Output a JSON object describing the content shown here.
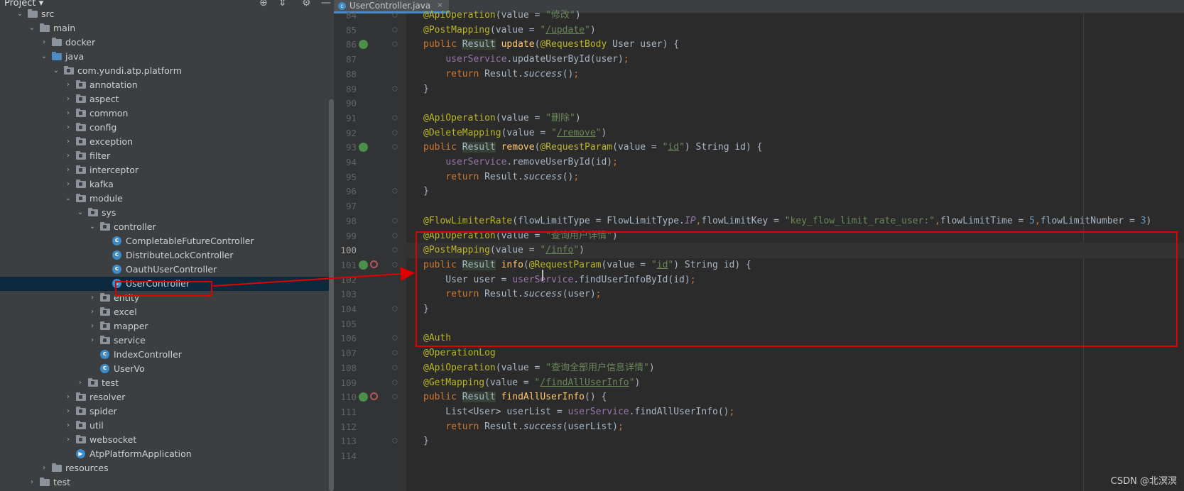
{
  "sidebar": {
    "title": "Project",
    "tree": [
      {
        "label": "src",
        "indent": 1,
        "chev": "down",
        "icon": "folder"
      },
      {
        "label": "main",
        "indent": 2,
        "chev": "down",
        "icon": "folder"
      },
      {
        "label": "docker",
        "indent": 3,
        "chev": "right",
        "icon": "folder"
      },
      {
        "label": "java",
        "indent": 3,
        "chev": "down",
        "icon": "folder-blue"
      },
      {
        "label": "com.yundi.atp.platform",
        "indent": 4,
        "chev": "down",
        "icon": "pkg"
      },
      {
        "label": "annotation",
        "indent": 5,
        "chev": "right",
        "icon": "pkg"
      },
      {
        "label": "aspect",
        "indent": 5,
        "chev": "right",
        "icon": "pkg"
      },
      {
        "label": "common",
        "indent": 5,
        "chev": "right",
        "icon": "pkg"
      },
      {
        "label": "config",
        "indent": 5,
        "chev": "right",
        "icon": "pkg"
      },
      {
        "label": "exception",
        "indent": 5,
        "chev": "right",
        "icon": "pkg"
      },
      {
        "label": "filter",
        "indent": 5,
        "chev": "right",
        "icon": "pkg"
      },
      {
        "label": "interceptor",
        "indent": 5,
        "chev": "right",
        "icon": "pkg"
      },
      {
        "label": "kafka",
        "indent": 5,
        "chev": "right",
        "icon": "pkg"
      },
      {
        "label": "module",
        "indent": 5,
        "chev": "down",
        "icon": "pkg"
      },
      {
        "label": "sys",
        "indent": 6,
        "chev": "down",
        "icon": "pkg"
      },
      {
        "label": "controller",
        "indent": 7,
        "chev": "down",
        "icon": "pkg"
      },
      {
        "label": "CompletableFutureController",
        "indent": 8,
        "chev": "none",
        "icon": "class"
      },
      {
        "label": "DistributeLockController",
        "indent": 8,
        "chev": "none",
        "icon": "class"
      },
      {
        "label": "OauthUserController",
        "indent": 8,
        "chev": "none",
        "icon": "class"
      },
      {
        "label": "UserController",
        "indent": 8,
        "chev": "none",
        "icon": "class",
        "selected": true
      },
      {
        "label": "entity",
        "indent": 7,
        "chev": "right",
        "icon": "pkg"
      },
      {
        "label": "excel",
        "indent": 7,
        "chev": "right",
        "icon": "pkg"
      },
      {
        "label": "mapper",
        "indent": 7,
        "chev": "right",
        "icon": "pkg"
      },
      {
        "label": "service",
        "indent": 7,
        "chev": "right",
        "icon": "pkg"
      },
      {
        "label": "IndexController",
        "indent": 7,
        "chev": "none",
        "icon": "class"
      },
      {
        "label": "UserVo",
        "indent": 7,
        "chev": "none",
        "icon": "class"
      },
      {
        "label": "test",
        "indent": 6,
        "chev": "right",
        "icon": "pkg"
      },
      {
        "label": "resolver",
        "indent": 5,
        "chev": "right",
        "icon": "pkg"
      },
      {
        "label": "spider",
        "indent": 5,
        "chev": "right",
        "icon": "pkg"
      },
      {
        "label": "util",
        "indent": 5,
        "chev": "right",
        "icon": "pkg"
      },
      {
        "label": "websocket",
        "indent": 5,
        "chev": "right",
        "icon": "pkg"
      },
      {
        "label": "AtpPlatformApplication",
        "indent": 5,
        "chev": "none",
        "icon": "app"
      },
      {
        "label": "resources",
        "indent": 3,
        "chev": "right",
        "icon": "folder"
      },
      {
        "label": "test",
        "indent": 2,
        "chev": "right",
        "icon": "folder"
      }
    ]
  },
  "editor": {
    "tab_label": "UserController.java",
    "tab_close": "×",
    "current_line": 100,
    "lines": [
      {
        "n": 84,
        "html": "<span class='a'>@ApiOperation</span>(value = <span class='s'>\"修改\"</span>)"
      },
      {
        "n": 85,
        "html": "<span class='a'>@PostMapping</span>(value = <span class='s'>\"<span class='u'>/update</span>\"</span>)"
      },
      {
        "n": 86,
        "html": "<span class='k'>public </span><span class='hl'>Result</span> <span class='m'>update</span>(<span class='a'>@RequestBody</span> User user) {",
        "g1": true
      },
      {
        "n": 87,
        "html": "    <span class='f'>userService</span>.updateUserById(user)<span class='k'>;</span>"
      },
      {
        "n": 88,
        "html": "    <span class='k'>return </span>Result.<span class='i'>success</span>()<span class='k'>;</span>"
      },
      {
        "n": 89,
        "html": "}"
      },
      {
        "n": 90,
        "html": ""
      },
      {
        "n": 91,
        "html": "<span class='a'>@ApiOperation</span>(value = <span class='s'>\"删除\"</span>)"
      },
      {
        "n": 92,
        "html": "<span class='a'>@DeleteMapping</span>(value = <span class='s'>\"<span class='u'>/remove</span>\"</span>)"
      },
      {
        "n": 93,
        "html": "<span class='k'>public </span><span class='hl'>Result</span> <span class='m'>remove</span>(<span class='a'>@RequestParam</span>(value = <span class='s'>\"<span class='u'>id</span>\"</span>) String id) {",
        "g1": true
      },
      {
        "n": 94,
        "html": "    <span class='f'>userService</span>.removeUserById(id)<span class='k'>;</span>"
      },
      {
        "n": 95,
        "html": "    <span class='k'>return </span>Result.<span class='i'>success</span>()<span class='k'>;</span>"
      },
      {
        "n": 96,
        "html": "}"
      },
      {
        "n": 97,
        "html": ""
      },
      {
        "n": 98,
        "html": "<span class='a'>@FlowLimiterRate</span>(flowLimitType = FlowLimitType.<span class='f i'>IP</span><span class='k'>,</span>flowLimitKey = <span class='s'>\"key_flow_limit_rate_user:\"</span><span class='k'>,</span>flowLimitTime = <span class='n'>5</span><span class='k'>,</span>flowLimitNumber = <span class='n'>3</span>)"
      },
      {
        "n": 99,
        "html": "<span class='a'>@ApiOperation</span>(value = <span class='s'>\"查询用户详情\"</span>)"
      },
      {
        "n": 100,
        "html": "<span class='a'>@PostMapping</span>(value = <span class='s'>\"<span class='u'>/info</span>\"</span>)"
      },
      {
        "n": 101,
        "html": "<span class='k'>public </span><span class='hl'>Result</span> <span class='m'>info</span>(<span class='a'>@RequestParam</span>(value = <span class='s'>\"<span class='u'>id</span>\"</span>) String id) {",
        "g1": true,
        "g2": true
      },
      {
        "n": 102,
        "html": "    User user = <span class='f'>userService</span>.findUserInfoById(id)<span class='k'>;</span>"
      },
      {
        "n": 103,
        "html": "    <span class='k'>return </span>Result.<span class='i'>success</span>(user)<span class='k'>;</span>"
      },
      {
        "n": 104,
        "html": "}"
      },
      {
        "n": 105,
        "html": ""
      },
      {
        "n": 106,
        "html": "<span class='a'>@Auth</span>"
      },
      {
        "n": 107,
        "html": "<span class='a'>@OperationLog</span>"
      },
      {
        "n": 108,
        "html": "<span class='a'>@ApiOperation</span>(value = <span class='s'>\"查询全部用户信息详情\"</span>)"
      },
      {
        "n": 109,
        "html": "<span class='a'>@GetMapping</span>(value = <span class='s'>\"<span class='u'>/findAllUserInfo</span>\"</span>)"
      },
      {
        "n": 110,
        "html": "<span class='k'>public </span><span class='hl'>Result</span> <span class='m'>findAllUserInfo</span>() {",
        "g1": true,
        "g2": true
      },
      {
        "n": 111,
        "html": "    List&lt;User&gt; userList = <span class='f'>userService</span>.findAllUserInfo()<span class='k'>;</span>"
      },
      {
        "n": 112,
        "html": "    <span class='k'>return </span>Result.<span class='i'>success</span>(userList)<span class='k'>;</span>"
      },
      {
        "n": 113,
        "html": "}"
      },
      {
        "n": 114,
        "html": ""
      }
    ]
  },
  "watermark": "CSDN @北溟溟"
}
